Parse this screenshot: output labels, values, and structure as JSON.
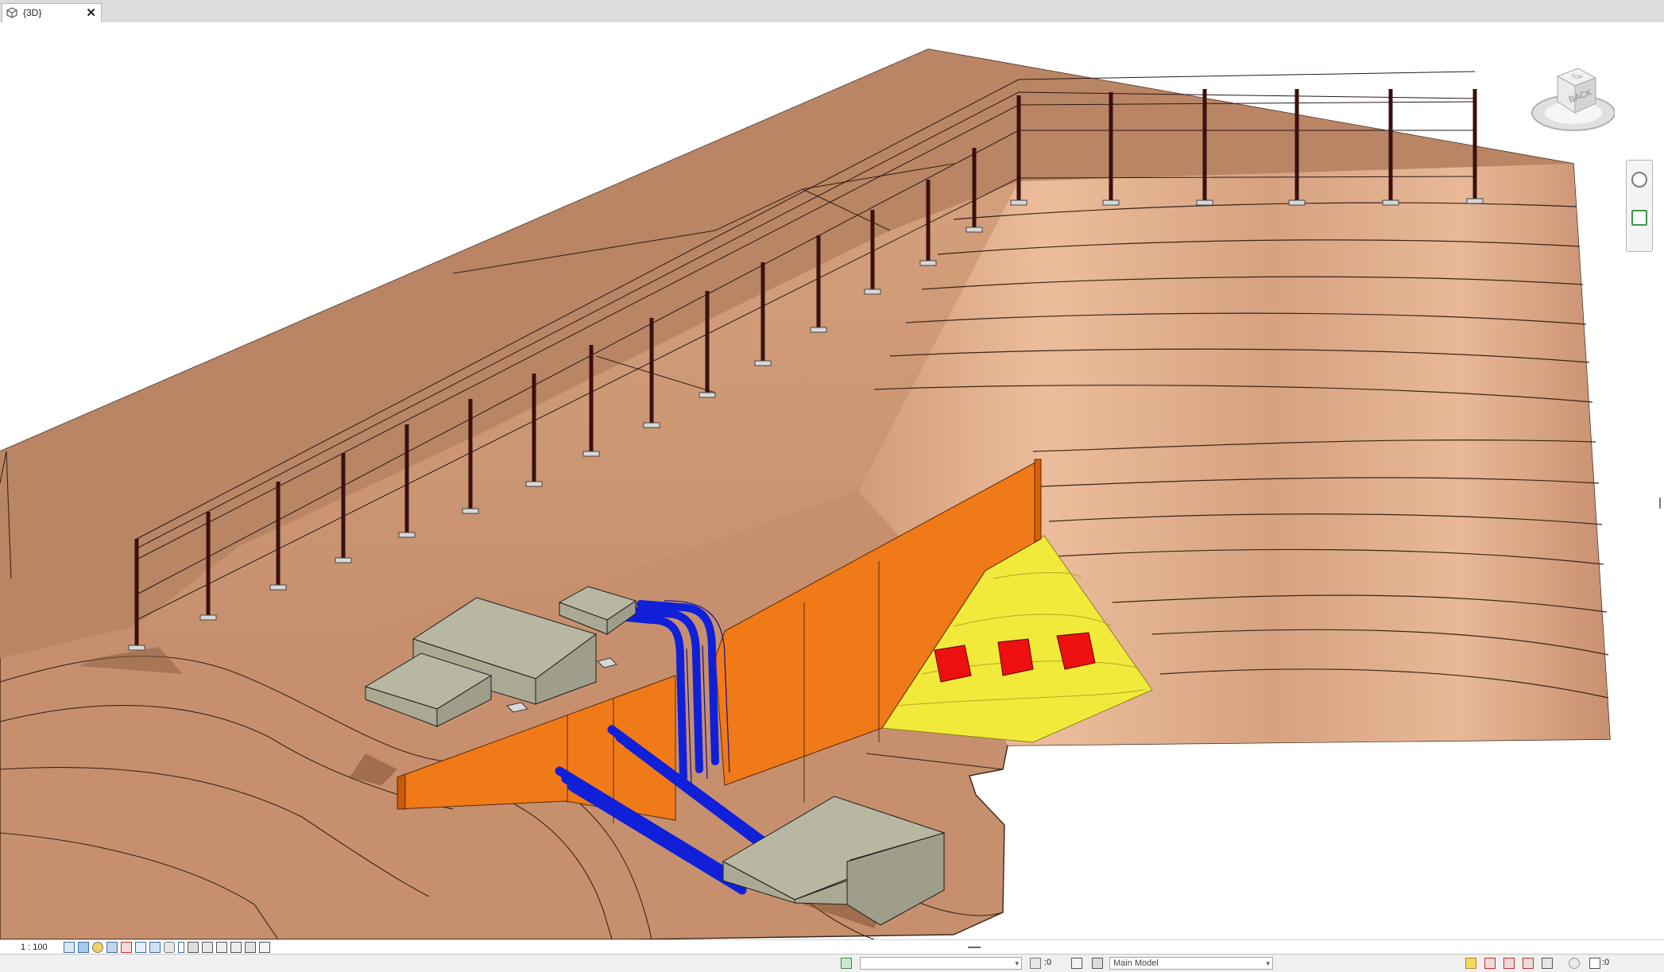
{
  "tab": {
    "label": "{3D}",
    "close_label": "✕"
  },
  "viewcube": {
    "face_label": "BACK",
    "top_label": "TOP"
  },
  "status": {
    "scale": "1 : 100"
  },
  "bottom": {
    "workset_value": "",
    "selection_count": ":0",
    "design_option": "Main Model",
    "filter_count": ":0"
  },
  "colors": {
    "terrain": "#c6906e",
    "terrain_upper": "#b98565",
    "terrain_light": "#e8b898",
    "retaining_wall": "#f07a18",
    "slope_zone": "#f2ea3a",
    "drain_outlet": "#ee1010",
    "pipes": "#1020d8",
    "buildings": "#b8b8a2",
    "fence_post": "#3a1010"
  },
  "icons": {
    "tab": "3d-view-icon",
    "viewcube": "viewcube-icon",
    "navigation": "navigation-bar-icon",
    "view_controls": [
      "detail-level-icon",
      "visual-style-icon",
      "sun-path-icon",
      "shadows-icon",
      "crop-view-icon",
      "show-crop-icon",
      "temporary-hide-icon",
      "reveal-hidden-icon",
      "lock-3d-icon",
      "analysis-display-icon",
      "highlight-displacement-icon",
      "constraints-icon"
    ],
    "bottom_right": [
      "select-links-icon",
      "select-underlay-icon",
      "select-pinned-icon",
      "select-by-face-icon",
      "drag-elements-icon",
      "background-processes-icon",
      "filter-icon"
    ]
  }
}
